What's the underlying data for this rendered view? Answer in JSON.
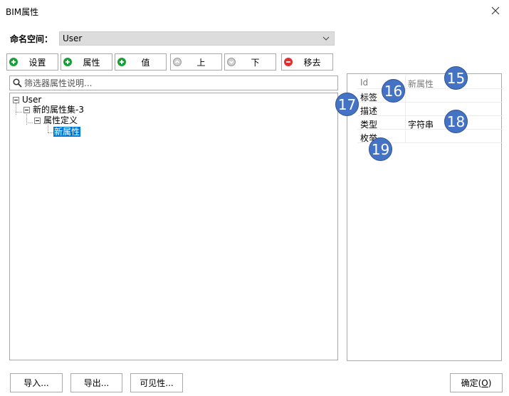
{
  "window": {
    "title": "BIM属性"
  },
  "namespace": {
    "label": "命名空间：",
    "value": "User"
  },
  "toolbar": {
    "set": "设置",
    "property": "属性",
    "value": "值",
    "up": "上",
    "down": "下",
    "remove": "移去"
  },
  "filter": {
    "placeholder": "筛选器属性说明..."
  },
  "tree": {
    "root": "User",
    "set": "新的属性集-3",
    "definition": "属性定义",
    "selected": "新属性"
  },
  "properties": {
    "rows": [
      {
        "key": "Id",
        "value": "新属性"
      },
      {
        "key": "标签",
        "value": ""
      },
      {
        "key": "描述",
        "value": ""
      },
      {
        "key": "类型",
        "value": "字符串"
      },
      {
        "key": "枚举",
        "value": ""
      }
    ]
  },
  "badges": [
    "15",
    "16",
    "17",
    "18",
    "19"
  ],
  "buttons": {
    "import": "导入...",
    "export": "导出...",
    "visibility": "可见性...",
    "ok_prefix": "确定(",
    "ok_key": "O",
    "ok_suffix": ")"
  },
  "colors": {
    "accent": "#0078d7",
    "badge": "#4472c4",
    "add": "#1a9e3a",
    "remove": "#e03030"
  }
}
